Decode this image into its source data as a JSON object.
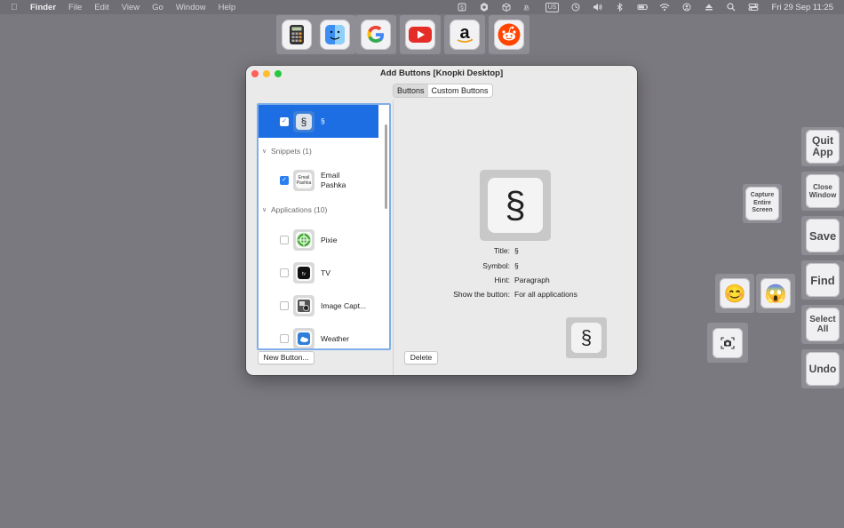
{
  "menubar": {
    "apple_icon": "apple-logo",
    "app": "Finder",
    "items": [
      "File",
      "Edit",
      "View",
      "Go",
      "Window",
      "Help"
    ],
    "keyboard_indicator": "US",
    "clock": "Fri 29 Sep  11:25"
  },
  "top_tiles": [
    "calculator-icon",
    "finder-icon",
    "google-icon",
    "youtube-icon",
    "amazon-icon",
    "reddit-icon"
  ],
  "window": {
    "title": "Add Buttons [Knopki Desktop]",
    "tabs": [
      "Buttons",
      "Custom Buttons"
    ],
    "selected_tab": "Buttons",
    "list": {
      "top_item": {
        "label": "§",
        "checked": true
      },
      "snippets_header": "Snippets (1)",
      "snippet_item": {
        "label_line1": "Email",
        "label_line2": "Pashka",
        "icon_text": "Email Pashka",
        "checked": true
      },
      "applications_header": "Applications (10)",
      "apps": [
        {
          "label": "Pixie",
          "checked": false
        },
        {
          "label": "TV",
          "checked": false
        },
        {
          "label": "Image Capt...",
          "checked": false
        },
        {
          "label": "Weather",
          "checked": false
        }
      ]
    },
    "new_button_label": "New Button...",
    "delete_label": "Delete",
    "preview": {
      "symbol": "§",
      "fields": [
        {
          "label": "Title:",
          "value": "§"
        },
        {
          "label": "Symbol:",
          "value": "§"
        },
        {
          "label": "Hint:",
          "value": "Paragraph"
        },
        {
          "label": "Show the button:",
          "value": "For all applications"
        }
      ]
    }
  },
  "floating": {
    "capture": "Capture Entire Screen",
    "quit": "Quit App",
    "close": "Close Window",
    "save": "Save",
    "find": "Find",
    "select_all": "Select All",
    "undo": "Undo",
    "emoji_smile": "😊",
    "emoji_scream": "😱"
  }
}
